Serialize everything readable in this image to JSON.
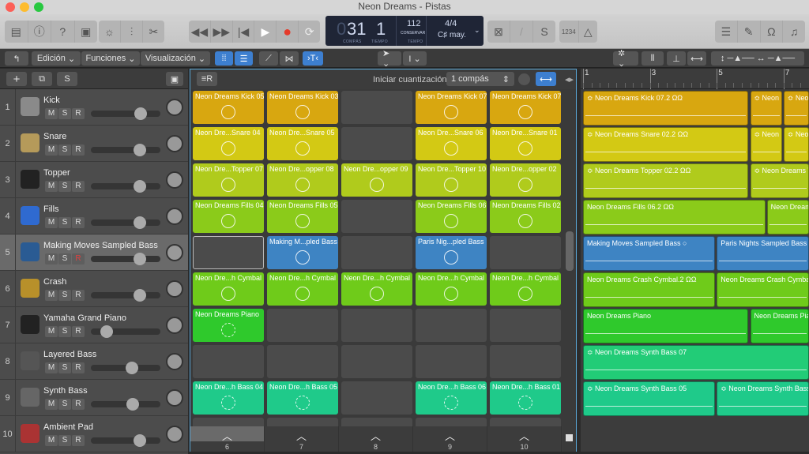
{
  "window": {
    "title": "Neon Dreams - Pistas"
  },
  "control_bar": {
    "left_icons": [
      "library-icon",
      "info-icon",
      "help-icon",
      "toolbar-icon"
    ],
    "edit_icons": [
      "smart-controls-icon",
      "mixer-icon",
      "scissors-icon"
    ],
    "transport_icons": [
      "rewind-icon",
      "fast-forward-icon",
      "go-to-start-icon",
      "play-icon",
      "record-icon",
      "cycle-icon"
    ],
    "lcd": {
      "bar": "31",
      "bar_prefix": "0",
      "beat": "1",
      "bar_label": "COMPÁS",
      "beat_label": "TIEMPO",
      "tempo": "112",
      "tempo_mode": "CONSERVAR",
      "tempo_label": "TEMPO",
      "signature": "4/4",
      "key": "C♯ may."
    },
    "mode_icons": [
      "replace-icon",
      "tuner-icon",
      "solo-icon"
    ],
    "count_in": "1234",
    "right_icons": [
      "list-editors-icon",
      "notepad-icon",
      "loop-browser-icon",
      "browsers-icon"
    ]
  },
  "toolbar": {
    "back_icon": "back-icon",
    "menus": [
      "Edición",
      "Funciones",
      "Visualización"
    ],
    "pointer_tool": "pointer-icon",
    "text_tool": "text-cursor-icon"
  },
  "track_header": {
    "add": "+",
    "solo": "S"
  },
  "cell_header": {
    "quantize_label": "Iniciar cuantización:",
    "quantize_value": "1 compás"
  },
  "ruler": {
    "bars": [
      "1",
      "3",
      "5",
      "7"
    ]
  },
  "colors": {
    "kick": "#d8a710",
    "snare": "#d3c914",
    "topper": "#b0cb1c",
    "fills": "#8bcb1a",
    "bass": "#3e84c3",
    "crash": "#6fcb1a",
    "piano": "#2fc92c",
    "synth": "#1fca8a",
    "synth_region": "#22cc77"
  },
  "tracks": [
    {
      "num": "1",
      "name": "Kick",
      "color": "#8a8a8a",
      "vol": 0.74
    },
    {
      "num": "2",
      "name": "Snare",
      "color": "#b59a5a",
      "vol": 0.72
    },
    {
      "num": "3",
      "name": "Topper",
      "color": "#222",
      "vol": 0.72
    },
    {
      "num": "4",
      "name": "Fills",
      "color": "#2f6ad0",
      "vol": 0.72
    },
    {
      "num": "5",
      "name": "Making Moves Sampled Bass",
      "color": "#2a5b93",
      "vol": 0.72,
      "selected": true,
      "record_armed": true
    },
    {
      "num": "6",
      "name": "Crash",
      "color": "#b8902a",
      "vol": 0.72
    },
    {
      "num": "7",
      "name": "Yamaha Grand Piano",
      "color": "#222",
      "vol": 0.2
    },
    {
      "num": "8",
      "name": "Layered Bass",
      "color": "#555",
      "vol": 0.6
    },
    {
      "num": "9",
      "name": "Synth Bass",
      "color": "#666",
      "vol": 0.61
    },
    {
      "num": "10",
      "name": "Ambient Pad",
      "color": "#a33",
      "vol": 0.72
    }
  ],
  "track_buttons": {
    "mute": "M",
    "solo": "S",
    "record": "R",
    "pan_l": "L",
    "pan_r": "R"
  },
  "cells": [
    [
      {
        "t": "Neon Dreams Kick 05",
        "c": "kick"
      },
      {
        "t": "Neon Dreams Kick 03",
        "c": "kick"
      },
      null,
      {
        "t": "Neon Dreams Kick 07",
        "c": "kick"
      },
      {
        "t": "Neon Dreams Kick 07",
        "c": "kick"
      }
    ],
    [
      {
        "t": "Neon Dre...Snare 04",
        "c": "snare"
      },
      {
        "t": "Neon Dre...Snare 05",
        "c": "snare"
      },
      null,
      {
        "t": "Neon Dre...Snare 06",
        "c": "snare"
      },
      {
        "t": "Neon Dre...Snare 01",
        "c": "snare"
      }
    ],
    [
      {
        "t": "Neon Dre...Topper 07",
        "c": "topper"
      },
      {
        "t": "Neon Dre...opper 08",
        "c": "topper"
      },
      {
        "t": "Neon Dre...opper 09",
        "c": "topper"
      },
      {
        "t": "Neon Dre...Topper 10",
        "c": "topper"
      },
      {
        "t": "Neon Dre...opper 02",
        "c": "topper"
      }
    ],
    [
      {
        "t": "Neon Dreams Fills 04",
        "c": "fills"
      },
      {
        "t": "Neon Dreams Fills 05",
        "c": "fills"
      },
      null,
      {
        "t": "Neon Dreams Fills 06",
        "c": "fills"
      },
      {
        "t": "Neon Dreams Fills 02",
        "c": "fills"
      }
    ],
    [
      null,
      {
        "t": "Making M...pled Bass",
        "c": "bass"
      },
      null,
      {
        "t": "Paris Nig...pled Bass",
        "c": "bass"
      },
      null
    ],
    [
      {
        "t": "Neon Dre...h Cymbal",
        "c": "crash"
      },
      {
        "t": "Neon Dre...h Cymbal",
        "c": "crash"
      },
      {
        "t": "Neon Dre...h Cymbal",
        "c": "crash"
      },
      {
        "t": "Neon Dre...h Cymbal",
        "c": "crash"
      },
      {
        "t": "Neon Dre...h Cymbal",
        "c": "crash"
      }
    ],
    [
      {
        "t": "Neon Dreams Piano",
        "c": "piano"
      },
      null,
      null,
      null,
      null
    ],
    [
      null,
      null,
      null,
      null,
      null
    ],
    [
      {
        "t": "Neon Dre...h Bass 04",
        "c": "synth"
      },
      {
        "t": "Neon Dre...h Bass 05",
        "c": "synth"
      },
      null,
      {
        "t": "Neon Dre...h Bass 06",
        "c": "synth"
      },
      {
        "t": "Neon Dre...h Bass 01",
        "c": "synth"
      }
    ]
  ],
  "scenes": [
    "6",
    "7",
    "8",
    "9",
    "10"
  ],
  "regions": [
    [
      {
        "t": "≎ Neon Dreams Kick 07.2 ΩΩ",
        "c": "kick",
        "s": 1,
        "e": 5.95
      },
      {
        "t": "≎ Neon D",
        "c": "kick",
        "s": 6,
        "e": 6.95
      },
      {
        "t": "≎ Neon",
        "c": "kick",
        "s": 7,
        "e": 8
      }
    ],
    [
      {
        "t": "≎ Neon Dreams Snare 02.2 ΩΩ",
        "c": "snare",
        "s": 1,
        "e": 5.95
      },
      {
        "t": "≎ Neon D",
        "c": "snare",
        "s": 6,
        "e": 6.95
      },
      {
        "t": "≎ Neon",
        "c": "snare",
        "s": 7,
        "e": 8
      }
    ],
    [
      {
        "t": "≎ Neon Dreams Topper 02.2 ΩΩ",
        "c": "topper",
        "s": 1,
        "e": 5.95
      },
      {
        "t": "≎ Neon Dreams T",
        "c": "topper",
        "s": 6,
        "e": 8
      }
    ],
    [
      {
        "t": "Neon Dreams Fills 06.2 ΩΩ",
        "c": "fills",
        "s": 1,
        "e": 6.45
      },
      {
        "t": "Neon Dream",
        "c": "fills",
        "s": 6.5,
        "e": 8
      }
    ],
    [
      {
        "t": "Making Moves Sampled Bass  ○",
        "c": "bass",
        "s": 1,
        "e": 4.95
      },
      {
        "t": "Paris Nights Sampled Bass",
        "c": "bass",
        "s": 5,
        "e": 8
      }
    ],
    [
      {
        "t": "Neon Dreams Crash Cymbal.2 ΩΩ",
        "c": "crash",
        "s": 1,
        "e": 4.95
      },
      {
        "t": "Neon Dreams Crash Cymbal",
        "c": "crash",
        "s": 5,
        "e": 8
      }
    ],
    [
      {
        "t": "Neon Dreams Piano",
        "c": "piano",
        "s": 1,
        "e": 5.95
      },
      {
        "t": "Neon Dreams Pia",
        "c": "piano",
        "s": 6,
        "e": 8
      }
    ],
    [
      {
        "t": "≎ Neon Dreams Synth Bass 07",
        "c": "synth_region",
        "s": 1,
        "e": 8
      }
    ],
    [
      {
        "t": "≎ Neon Dreams Synth Bass 05",
        "c": "synth",
        "s": 1,
        "e": 4.95
      },
      {
        "t": "≎ Neon Dreams Synth Bass 0",
        "c": "synth",
        "s": 5,
        "e": 8
      }
    ]
  ]
}
